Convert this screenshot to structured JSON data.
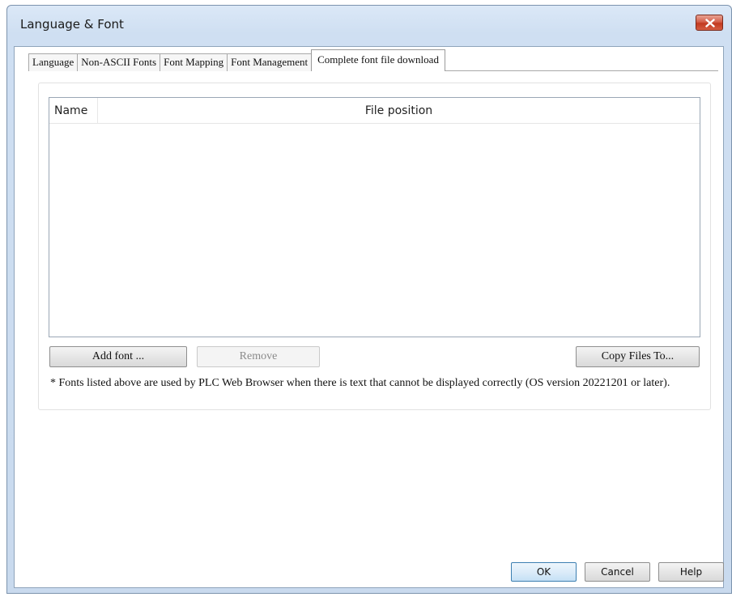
{
  "window": {
    "title": "Language & Font"
  },
  "tabs": [
    {
      "label": "Language"
    },
    {
      "label": "Non-ASCII Fonts"
    },
    {
      "label": "Font Mapping"
    },
    {
      "label": "Font Management"
    },
    {
      "label": "Complete font file download"
    }
  ],
  "active_tab": "Complete font file download",
  "list": {
    "columns": [
      {
        "label": "Name"
      },
      {
        "label": "File position"
      }
    ],
    "rows": []
  },
  "buttons": {
    "add_font": "Add font ...",
    "remove": "Remove",
    "copy_files": "Copy Files To..."
  },
  "note": "* Fonts listed above are used by PLC Web Browser when there is text that cannot be displayed correctly (OS version 20221201 or later).",
  "footer": {
    "ok": "OK",
    "cancel": "Cancel",
    "help": "Help"
  },
  "colors": {
    "close_button": "#c2391f",
    "frame": "#cfdff2"
  }
}
